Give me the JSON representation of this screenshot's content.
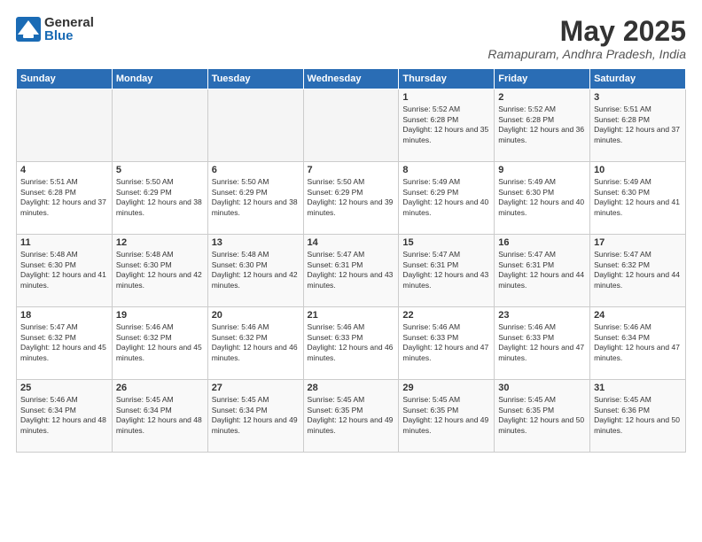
{
  "header": {
    "logo_general": "General",
    "logo_blue": "Blue",
    "month_title": "May 2025",
    "location": "Ramapuram, Andhra Pradesh, India"
  },
  "days_of_week": [
    "Sunday",
    "Monday",
    "Tuesday",
    "Wednesday",
    "Thursday",
    "Friday",
    "Saturday"
  ],
  "weeks": [
    [
      {
        "day": "",
        "empty": true
      },
      {
        "day": "",
        "empty": true
      },
      {
        "day": "",
        "empty": true
      },
      {
        "day": "",
        "empty": true
      },
      {
        "day": "1",
        "sunrise": "5:52 AM",
        "sunset": "6:28 PM",
        "daylight": "12 hours and 35 minutes."
      },
      {
        "day": "2",
        "sunrise": "5:52 AM",
        "sunset": "6:28 PM",
        "daylight": "12 hours and 36 minutes."
      },
      {
        "day": "3",
        "sunrise": "5:51 AM",
        "sunset": "6:28 PM",
        "daylight": "12 hours and 37 minutes."
      }
    ],
    [
      {
        "day": "4",
        "sunrise": "5:51 AM",
        "sunset": "6:28 PM",
        "daylight": "12 hours and 37 minutes."
      },
      {
        "day": "5",
        "sunrise": "5:50 AM",
        "sunset": "6:29 PM",
        "daylight": "12 hours and 38 minutes."
      },
      {
        "day": "6",
        "sunrise": "5:50 AM",
        "sunset": "6:29 PM",
        "daylight": "12 hours and 38 minutes."
      },
      {
        "day": "7",
        "sunrise": "5:50 AM",
        "sunset": "6:29 PM",
        "daylight": "12 hours and 39 minutes."
      },
      {
        "day": "8",
        "sunrise": "5:49 AM",
        "sunset": "6:29 PM",
        "daylight": "12 hours and 40 minutes."
      },
      {
        "day": "9",
        "sunrise": "5:49 AM",
        "sunset": "6:30 PM",
        "daylight": "12 hours and 40 minutes."
      },
      {
        "day": "10",
        "sunrise": "5:49 AM",
        "sunset": "6:30 PM",
        "daylight": "12 hours and 41 minutes."
      }
    ],
    [
      {
        "day": "11",
        "sunrise": "5:48 AM",
        "sunset": "6:30 PM",
        "daylight": "12 hours and 41 minutes."
      },
      {
        "day": "12",
        "sunrise": "5:48 AM",
        "sunset": "6:30 PM",
        "daylight": "12 hours and 42 minutes."
      },
      {
        "day": "13",
        "sunrise": "5:48 AM",
        "sunset": "6:30 PM",
        "daylight": "12 hours and 42 minutes."
      },
      {
        "day": "14",
        "sunrise": "5:47 AM",
        "sunset": "6:31 PM",
        "daylight": "12 hours and 43 minutes."
      },
      {
        "day": "15",
        "sunrise": "5:47 AM",
        "sunset": "6:31 PM",
        "daylight": "12 hours and 43 minutes."
      },
      {
        "day": "16",
        "sunrise": "5:47 AM",
        "sunset": "6:31 PM",
        "daylight": "12 hours and 44 minutes."
      },
      {
        "day": "17",
        "sunrise": "5:47 AM",
        "sunset": "6:32 PM",
        "daylight": "12 hours and 44 minutes."
      }
    ],
    [
      {
        "day": "18",
        "sunrise": "5:47 AM",
        "sunset": "6:32 PM",
        "daylight": "12 hours and 45 minutes."
      },
      {
        "day": "19",
        "sunrise": "5:46 AM",
        "sunset": "6:32 PM",
        "daylight": "12 hours and 45 minutes."
      },
      {
        "day": "20",
        "sunrise": "5:46 AM",
        "sunset": "6:32 PM",
        "daylight": "12 hours and 46 minutes."
      },
      {
        "day": "21",
        "sunrise": "5:46 AM",
        "sunset": "6:33 PM",
        "daylight": "12 hours and 46 minutes."
      },
      {
        "day": "22",
        "sunrise": "5:46 AM",
        "sunset": "6:33 PM",
        "daylight": "12 hours and 47 minutes."
      },
      {
        "day": "23",
        "sunrise": "5:46 AM",
        "sunset": "6:33 PM",
        "daylight": "12 hours and 47 minutes."
      },
      {
        "day": "24",
        "sunrise": "5:46 AM",
        "sunset": "6:34 PM",
        "daylight": "12 hours and 47 minutes."
      }
    ],
    [
      {
        "day": "25",
        "sunrise": "5:46 AM",
        "sunset": "6:34 PM",
        "daylight": "12 hours and 48 minutes."
      },
      {
        "day": "26",
        "sunrise": "5:45 AM",
        "sunset": "6:34 PM",
        "daylight": "12 hours and 48 minutes."
      },
      {
        "day": "27",
        "sunrise": "5:45 AM",
        "sunset": "6:34 PM",
        "daylight": "12 hours and 49 minutes."
      },
      {
        "day": "28",
        "sunrise": "5:45 AM",
        "sunset": "6:35 PM",
        "daylight": "12 hours and 49 minutes."
      },
      {
        "day": "29",
        "sunrise": "5:45 AM",
        "sunset": "6:35 PM",
        "daylight": "12 hours and 49 minutes."
      },
      {
        "day": "30",
        "sunrise": "5:45 AM",
        "sunset": "6:35 PM",
        "daylight": "12 hours and 50 minutes."
      },
      {
        "day": "31",
        "sunrise": "5:45 AM",
        "sunset": "6:36 PM",
        "daylight": "12 hours and 50 minutes."
      }
    ]
  ]
}
